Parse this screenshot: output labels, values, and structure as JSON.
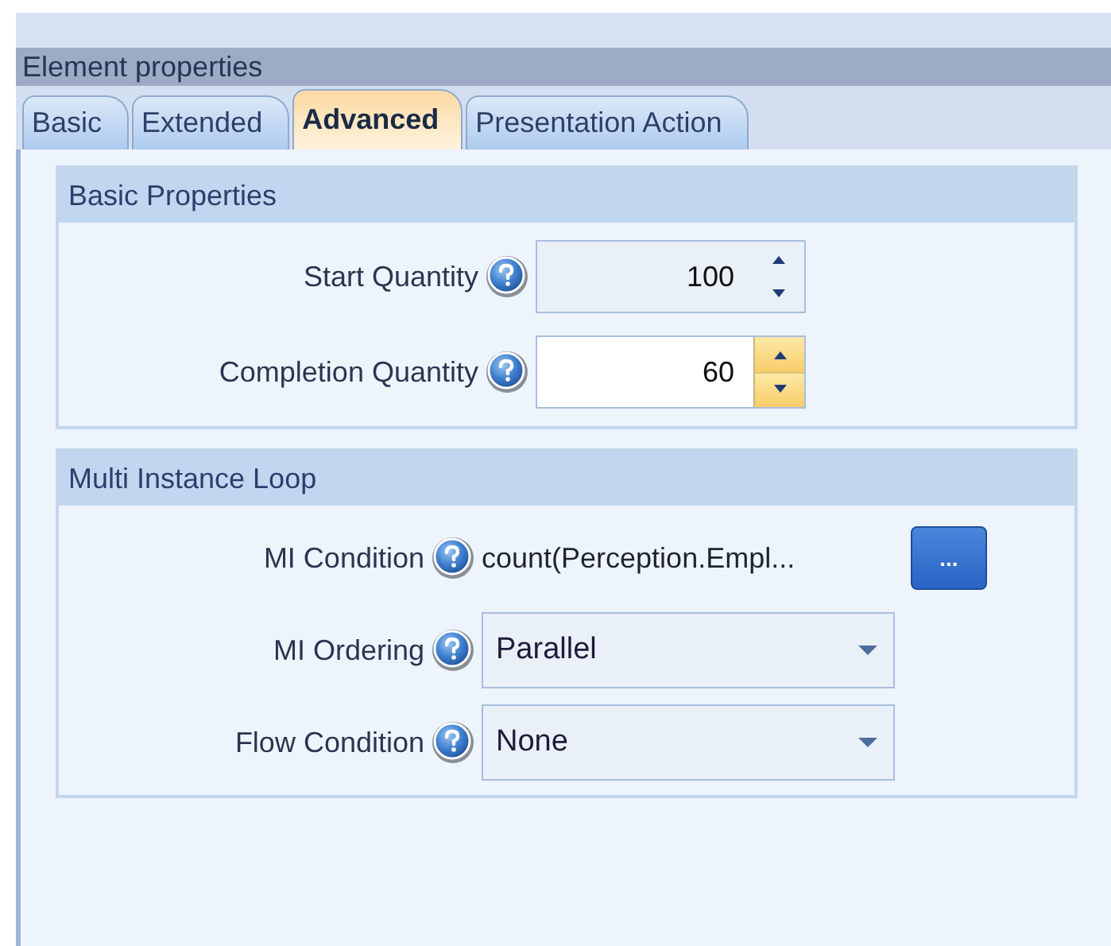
{
  "window": {
    "title": "Element properties"
  },
  "tabs": [
    {
      "label": "Basic",
      "selected": false
    },
    {
      "label": "Extended",
      "selected": false
    },
    {
      "label": "Advanced",
      "selected": true
    },
    {
      "label": "Presentation Action",
      "selected": false
    }
  ],
  "groups": [
    {
      "title": "Basic Properties",
      "fields": [
        {
          "kind": "spinner",
          "label": "Start Quantity",
          "value": "100",
          "focused": false
        },
        {
          "kind": "spinner",
          "label": "Completion Quantity",
          "value": "60",
          "focused": true
        }
      ]
    },
    {
      "title": "Multi Instance Loop",
      "fields": [
        {
          "kind": "text",
          "label": "MI Condition",
          "value": "count(Perception.Empl...",
          "button": "..."
        },
        {
          "kind": "dropdown",
          "label": "MI Ordering",
          "value": "Parallel"
        },
        {
          "kind": "dropdown",
          "label": "Flow Condition",
          "value": "None"
        }
      ]
    }
  ]
}
